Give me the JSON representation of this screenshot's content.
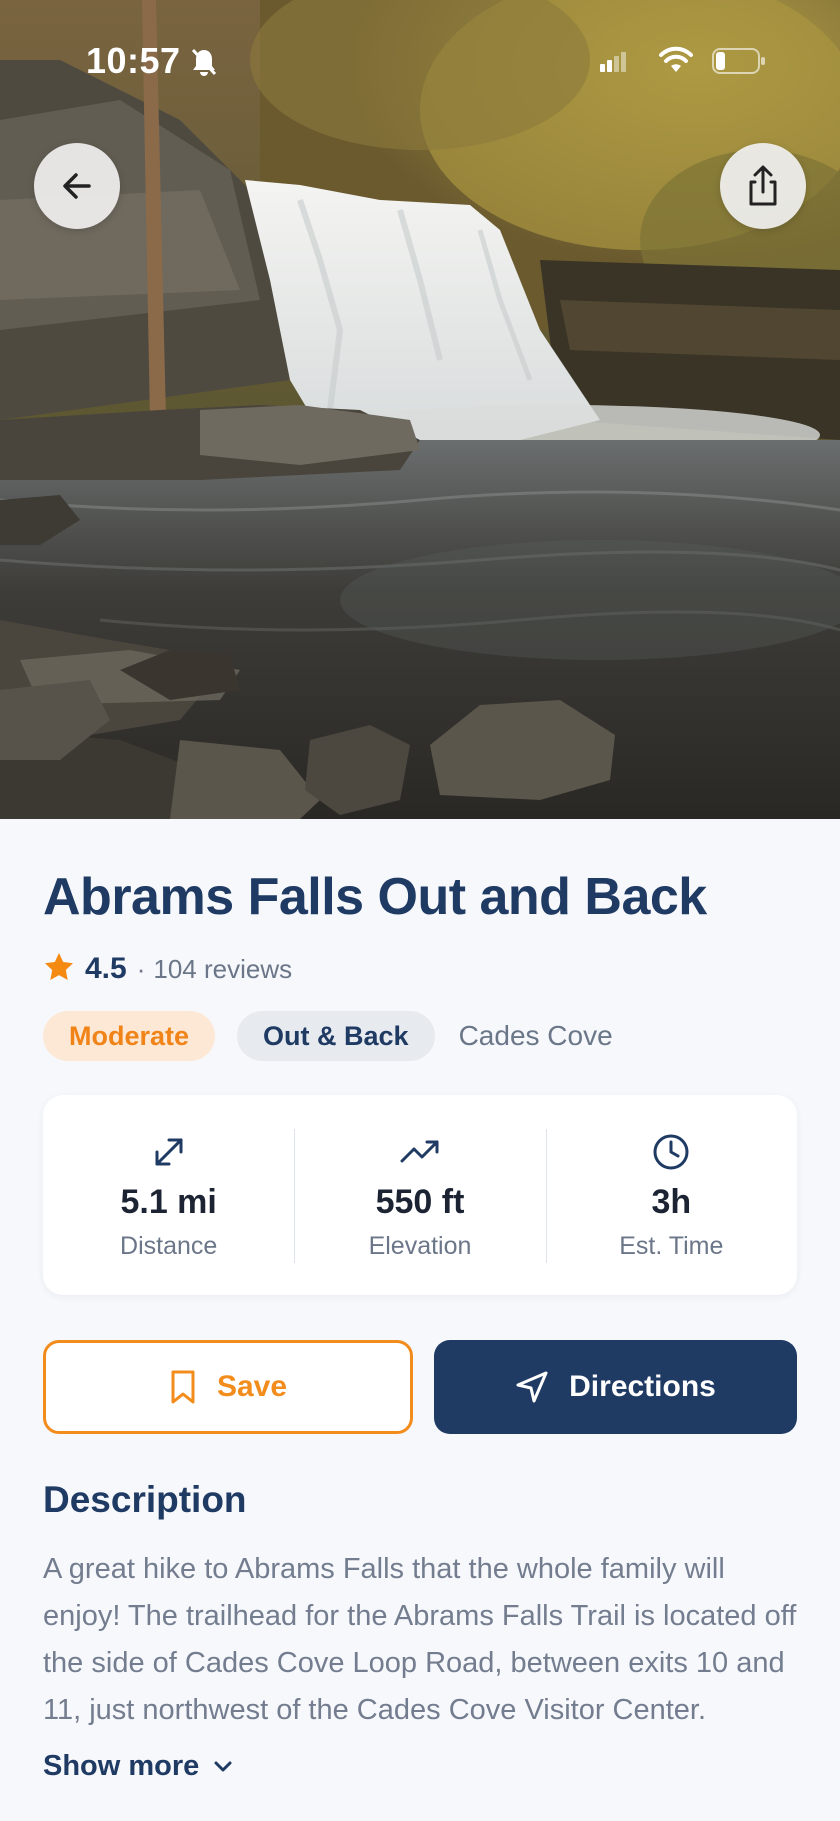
{
  "status_bar": {
    "time": "10:57",
    "icons": [
      "bell-slash-icon",
      "cellular-signal-icon",
      "wifi-icon",
      "battery-icon"
    ]
  },
  "hero": {
    "image": "waterfall-photo",
    "back_icon": "arrow-left-icon",
    "share_icon": "share-icon"
  },
  "trail": {
    "title": "Abrams Falls Out and Back",
    "rating": "4.5",
    "separator": "·",
    "reviews": "104 reviews",
    "tags": {
      "difficulty": "Moderate",
      "route_type": "Out & Back",
      "location": "Cades Cove"
    }
  },
  "stats": [
    {
      "icon": "expand-arrows-icon",
      "value": "5.1 mi",
      "label": "Distance"
    },
    {
      "icon": "trending-up-icon",
      "value": "550 ft",
      "label": "Elevation"
    },
    {
      "icon": "clock-icon",
      "value": "3h",
      "label": "Est. Time"
    }
  ],
  "actions": {
    "save_label": "Save",
    "directions_label": "Directions"
  },
  "description": {
    "heading": "Description",
    "text": "A great hike to Abrams Falls that the whole family will enjoy! The trailhead for the Abrams Falls Trail is located off the side of Cades Cove Loop Road, between exits 10 and 11, just northwest of the Cades Cove Visitor Center.",
    "show_more_label": "Show more"
  },
  "colors": {
    "primary_navy": "#1f3a63",
    "accent_orange": "#f28c1c",
    "moderate_tag_bg": "#fde8d6",
    "background": "#f6f8fb"
  }
}
